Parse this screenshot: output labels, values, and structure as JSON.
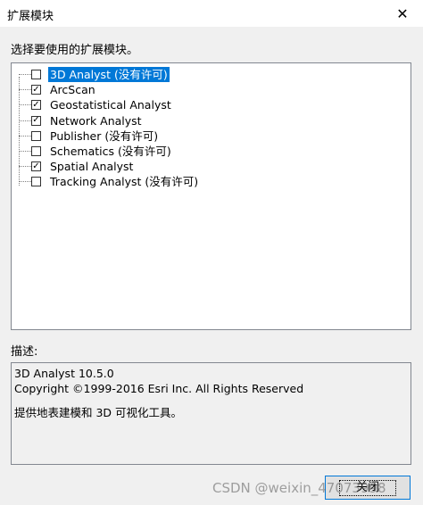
{
  "window": {
    "title": "扩展模块",
    "close_glyph": "✕"
  },
  "prompt": "选择要使用的扩展模块。",
  "extensions": [
    {
      "label": "3D Analyst (没有许可)",
      "checked": false,
      "selected": true
    },
    {
      "label": "ArcScan",
      "checked": true,
      "selected": false
    },
    {
      "label": "Geostatistical Analyst",
      "checked": true,
      "selected": false
    },
    {
      "label": "Network Analyst",
      "checked": true,
      "selected": false
    },
    {
      "label": "Publisher (没有许可)",
      "checked": false,
      "selected": false
    },
    {
      "label": "Schematics (没有许可)",
      "checked": false,
      "selected": false
    },
    {
      "label": "Spatial Analyst",
      "checked": true,
      "selected": false
    },
    {
      "label": "Tracking Analyst (没有许可)",
      "checked": false,
      "selected": false
    }
  ],
  "description": {
    "label": "描述:",
    "line1": "3D Analyst 10.5.0",
    "line2": "Copyright ©1999-2016 Esri Inc. All Rights Reserved",
    "line3": "提供地表建模和 3D 可视化工具。"
  },
  "buttons": {
    "close_label": "关闭"
  },
  "watermark": "CSDN @weixin_47073998",
  "colors": {
    "selection": "#0078d7",
    "dialog_bg": "#f0f0f0",
    "border": "#828790"
  }
}
